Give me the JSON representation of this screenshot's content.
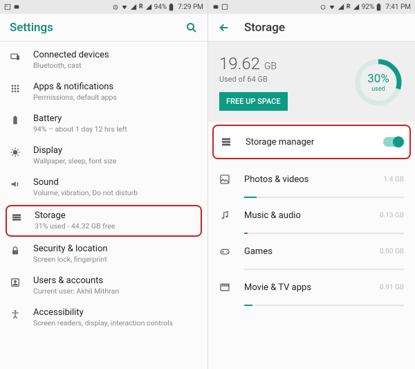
{
  "left": {
    "status": {
      "battery": "94%",
      "time": "7:29 PM",
      "roaming": "R"
    },
    "header": {
      "title": "Settings"
    },
    "items": [
      {
        "icon": "devices",
        "title": "Connected devices",
        "sub": "Bluetooth, cast"
      },
      {
        "icon": "apps",
        "title": "Apps & notifications",
        "sub": "Permissions, default apps"
      },
      {
        "icon": "battery",
        "title": "Battery",
        "sub": "94% – about 1 day 12 hrs left"
      },
      {
        "icon": "display",
        "title": "Display",
        "sub": "Wallpaper, sleep, font size"
      },
      {
        "icon": "sound",
        "title": "Sound",
        "sub": "Volume, vibration, Do not disturb"
      },
      {
        "icon": "storage",
        "title": "Storage",
        "sub": "31% used - 44.32 GB free",
        "highlighted": true
      },
      {
        "icon": "lock",
        "title": "Security & location",
        "sub": "Screen lock, fingerprint"
      },
      {
        "icon": "user",
        "title": "Users & accounts",
        "sub": "Current user: Akhil Mithran"
      },
      {
        "icon": "accessibility",
        "title": "Accessibility",
        "sub": "Screen readers, display, interaction controls"
      }
    ]
  },
  "right": {
    "status": {
      "battery": "92%",
      "time": "7:41 PM",
      "roaming": "R"
    },
    "header": {
      "title": "Storage"
    },
    "summary": {
      "used_value": "19.62",
      "used_unit": "GB",
      "used_of": "Used of 64 GB",
      "free_btn": "FREE UP SPACE",
      "pct": "30%",
      "pct_label": "used",
      "pct_num": 30
    },
    "manager": {
      "label": "Storage manager",
      "on": true
    },
    "categories": [
      {
        "icon": "photos",
        "label": "Photos & videos",
        "value": "1.4 GB",
        "fill": 8
      },
      {
        "icon": "music",
        "label": "Music & audio",
        "value": "0.13 GB",
        "fill": 2
      },
      {
        "icon": "games",
        "label": "Games",
        "value": "0.00 GB",
        "fill": 0
      },
      {
        "icon": "movies",
        "label": "Movie & TV apps",
        "value": "0.91 GB",
        "fill": 5
      }
    ]
  }
}
